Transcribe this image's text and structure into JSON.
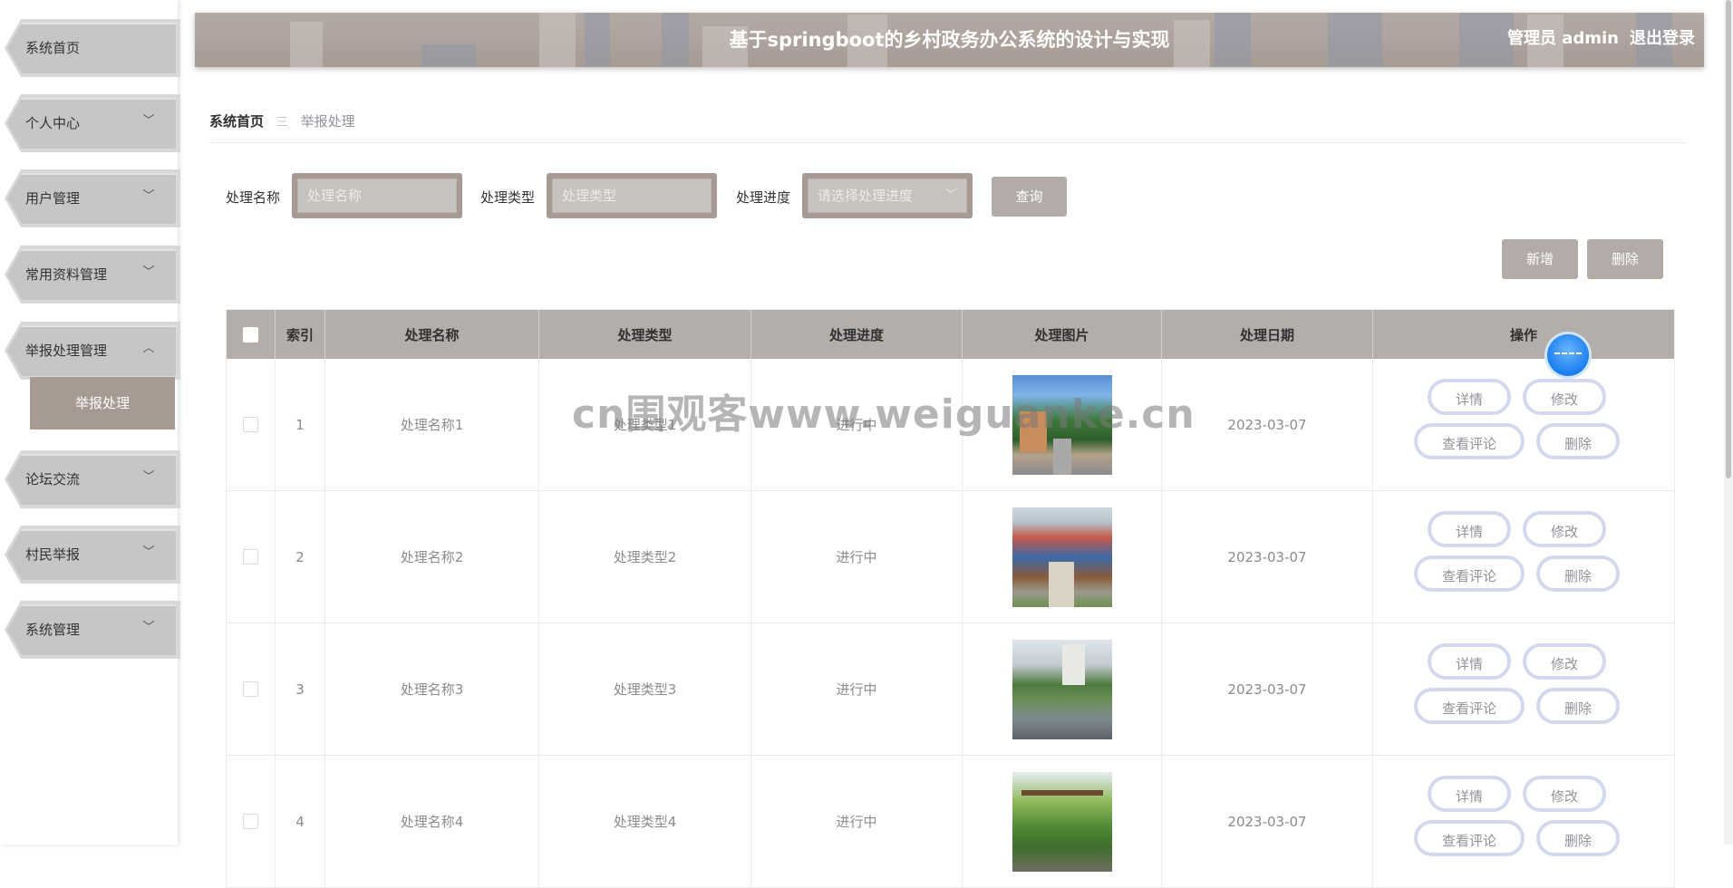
{
  "sidebar": {
    "items": [
      {
        "label": "系统首页",
        "has_chevron": false
      },
      {
        "label": "个人中心",
        "has_chevron": true
      },
      {
        "label": "用户管理",
        "has_chevron": true
      },
      {
        "label": "常用资料管理",
        "has_chevron": true
      },
      {
        "label": "举报处理管理",
        "has_chevron": true,
        "expanded": true
      },
      {
        "label": "论坛交流",
        "has_chevron": true
      },
      {
        "label": "村民举报",
        "has_chevron": true
      },
      {
        "label": "系统管理",
        "has_chevron": true
      }
    ],
    "active_sub": "举报处理",
    "chevron_down": "﹀",
    "chevron_up": "︿"
  },
  "header": {
    "title": "基于springboot的乡村政务办公系统的设计与实现",
    "user": "管理员 admin",
    "logout": "退出登录"
  },
  "breadcrumb": {
    "home": "系统首页",
    "separator": "三",
    "current": "举报处理"
  },
  "search": {
    "name_label": "处理名称",
    "name_placeholder": "处理名称",
    "type_label": "处理类型",
    "type_placeholder": "处理类型",
    "progress_label": "处理进度",
    "progress_placeholder": "请选择处理进度",
    "query_button": "查询"
  },
  "actions": {
    "add": "新增",
    "delete": "删除"
  },
  "table": {
    "headers": [
      "索引",
      "处理名称",
      "处理类型",
      "处理进度",
      "处理图片",
      "处理日期",
      "操作"
    ],
    "rows": [
      {
        "index": "1",
        "name": "处理名称1",
        "type": "处理类型1",
        "progress": "进行中",
        "date": "2023-03-07"
      },
      {
        "index": "2",
        "name": "处理名称2",
        "type": "处理类型2",
        "progress": "进行中",
        "date": "2023-03-07"
      },
      {
        "index": "3",
        "name": "处理名称3",
        "type": "处理类型3",
        "progress": "进行中",
        "date": "2023-03-07"
      },
      {
        "index": "4",
        "name": "处理名称4",
        "type": "处理类型4",
        "progress": "进行中",
        "date": "2023-03-07"
      }
    ],
    "row_ops": {
      "detail": "详情",
      "edit": "修改",
      "comments": "查看评论",
      "delete": "删除"
    }
  },
  "watermark": "cn围观客www.weiguanke.cn",
  "colors": {
    "accent": "#a69a93",
    "header_bg": "#b4aeab",
    "op_border": "#d4d8ef"
  }
}
